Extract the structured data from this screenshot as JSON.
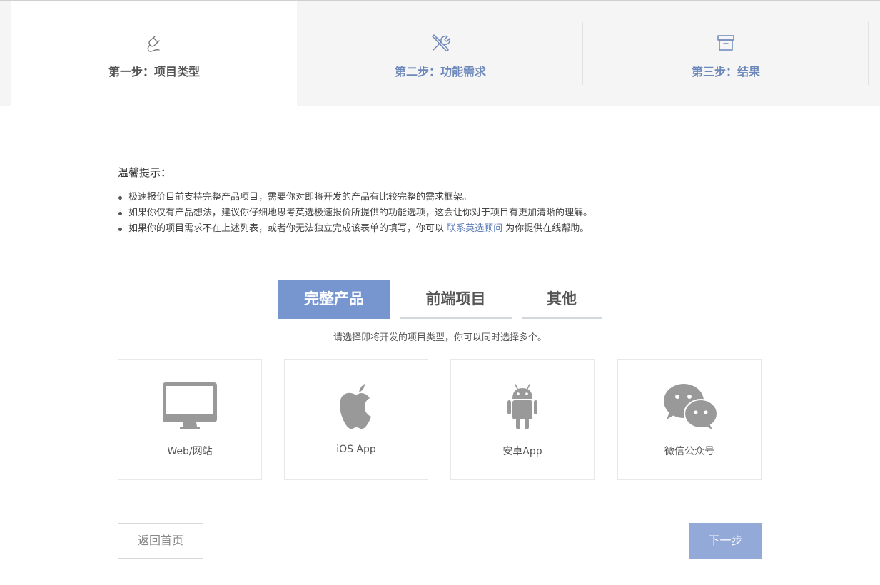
{
  "steps": [
    {
      "label": "第一步：项目类型",
      "icon": "plug-icon",
      "active": true
    },
    {
      "label": "第二步：功能需求",
      "icon": "tools-icon",
      "active": false
    },
    {
      "label": "第三步：结果",
      "icon": "archive-box-icon",
      "active": false
    }
  ],
  "tips": {
    "title": "温馨提示：",
    "items": [
      "极速报价目前支持完整产品项目，需要你对即将开发的产品有比较完整的需求框架。",
      "如果你仅有产品想法，建议你仔细地思考英选极速报价所提供的功能选项，这会让你对于项目有更加清晰的理解。"
    ],
    "item3_before": "如果你的项目需求不在上述列表，或者你无法独立完成该表单的填写，你可以 ",
    "item3_link": "联系英选顾问",
    "item3_after": " 为你提供在线帮助。"
  },
  "tabs": [
    {
      "label": "完整产品",
      "selected": true
    },
    {
      "label": "前端项目",
      "selected": false
    },
    {
      "label": "其他",
      "selected": false
    }
  ],
  "hint": "请选择即将开发的项目类型，你可以同时选择多个。",
  "cards": [
    {
      "label": "Web/网站",
      "icon": "monitor-icon"
    },
    {
      "label": "iOS App",
      "icon": "apple-icon"
    },
    {
      "label": "安卓App",
      "icon": "android-icon"
    },
    {
      "label": "微信公众号",
      "icon": "wechat-icon"
    }
  ],
  "buttons": {
    "back": "返回首页",
    "next": "下一步"
  },
  "colors": {
    "accent": "#7795cf",
    "next_button": "#93aad8",
    "step_label": "#6d88ba",
    "link": "#5d7cb6",
    "icon_gray": "#999999"
  }
}
